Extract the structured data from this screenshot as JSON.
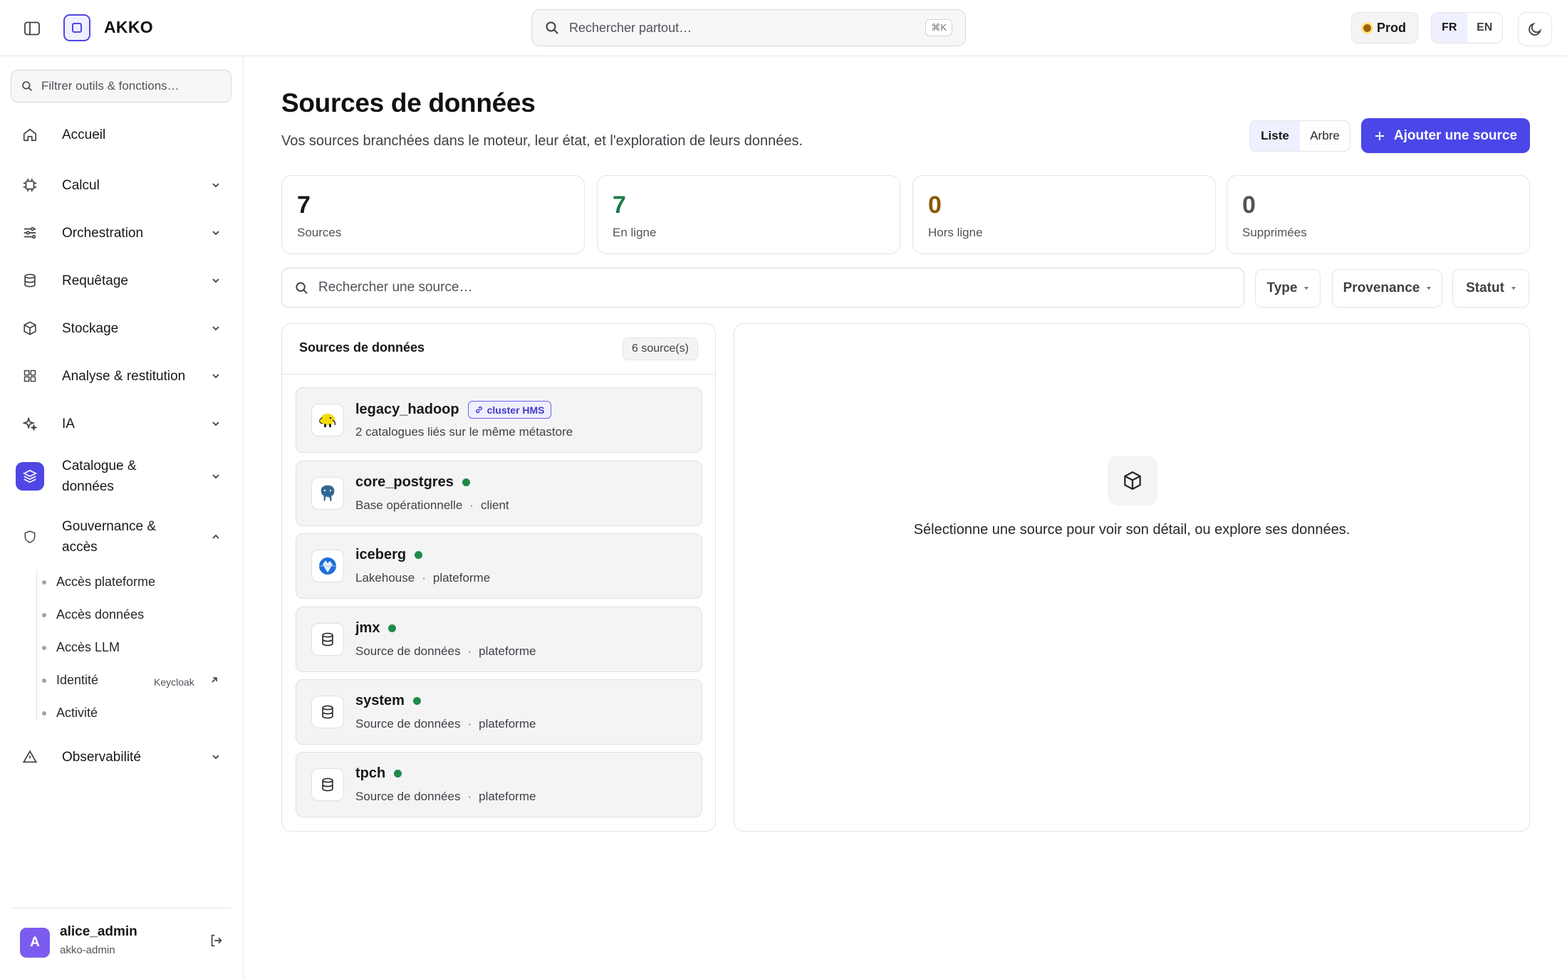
{
  "header": {
    "app_name": "AKKO",
    "search_placeholder": "Rechercher partout…",
    "search_shortcut": "⌘K",
    "environment": "Prod",
    "languages": [
      "FR",
      "EN"
    ],
    "active_language": "FR",
    "icons": [
      "sidebar-toggle-icon",
      "search-icon",
      "moon-icon"
    ]
  },
  "sidebar": {
    "filter_placeholder": "Filtrer outils & fonctions…",
    "items": [
      {
        "label": "Accueil",
        "icon": "home-icon"
      },
      {
        "label": "Calcul",
        "icon": "cpu-icon"
      },
      {
        "label": "Orchestration",
        "icon": "sliders-icon"
      },
      {
        "label": "Requêtage",
        "icon": "database-icon"
      },
      {
        "label": "Stockage",
        "icon": "box-icon"
      },
      {
        "label": "Analyse & restitution",
        "icon": "grid-icon"
      },
      {
        "label": "IA",
        "icon": "sparkles-icon"
      },
      {
        "label": "Catalogue & données",
        "icon": "layers-icon"
      },
      {
        "label": "Gouvernance & accès",
        "icon": "shield-icon"
      },
      {
        "label": "Observabilité",
        "icon": "alert-triangle-icon"
      }
    ],
    "subitems": [
      {
        "label": "Accès plateforme"
      },
      {
        "label": "Accès données"
      },
      {
        "label": "Accès LLM"
      },
      {
        "label": "Identité",
        "tag": "Keycloak"
      },
      {
        "label": "Activité"
      }
    ],
    "user": {
      "initial": "A",
      "name": "alice_admin",
      "role": "akko-admin"
    }
  },
  "main": {
    "title": "Sources de données",
    "subtitle": "Vos sources branchées dans le moteur, leur état, et l'exploration de leurs données.",
    "view_toggle": [
      "Liste",
      "Arbre"
    ],
    "active_view": "Liste",
    "add_button": "Ajouter une source",
    "stats": [
      {
        "value": "7",
        "label": "Sources",
        "color": "#18181b"
      },
      {
        "value": "7",
        "label": "En ligne",
        "color": "#1f7a4c"
      },
      {
        "value": "0",
        "label": "Hors ligne",
        "color": "#8a5a00"
      },
      {
        "value": "0",
        "label": "Supprimées",
        "color": "#52525b"
      }
    ],
    "search_placeholder": "Rechercher une source…",
    "filters": [
      "Type",
      "Provenance",
      "Statut"
    ],
    "list": {
      "title": "Sources de données",
      "count": "6 source(s)",
      "sources": [
        {
          "name": "legacy_hadoop",
          "badge": "cluster HMS",
          "desc": "2 catalogues liés sur le même métastore",
          "scope": "",
          "icon": "hadoop-elephant-icon",
          "online": false
        },
        {
          "name": "core_postgres",
          "badge": "",
          "desc": "Base opérationnelle",
          "scope": "client",
          "icon": "postgres-elephant-icon",
          "online": true
        },
        {
          "name": "iceberg",
          "badge": "",
          "desc": "Lakehouse",
          "scope": "plateforme",
          "icon": "iceberg-globe-icon",
          "online": true
        },
        {
          "name": "jmx",
          "badge": "",
          "desc": "Source de données",
          "scope": "plateforme",
          "icon": "database-icon",
          "online": true
        },
        {
          "name": "system",
          "badge": "",
          "desc": "Source de données",
          "scope": "plateforme",
          "icon": "database-icon",
          "online": true
        },
        {
          "name": "tpch",
          "badge": "",
          "desc": "Source de données",
          "scope": "plateforme",
          "icon": "database-icon",
          "online": true
        }
      ]
    },
    "detail": {
      "empty_text": "Sélectionne une source pour voir son détail, ou explore ses données.",
      "icon": "box-icon"
    }
  },
  "colors": {
    "accent": "#4a46e8",
    "online": "#1f8a4c"
  }
}
